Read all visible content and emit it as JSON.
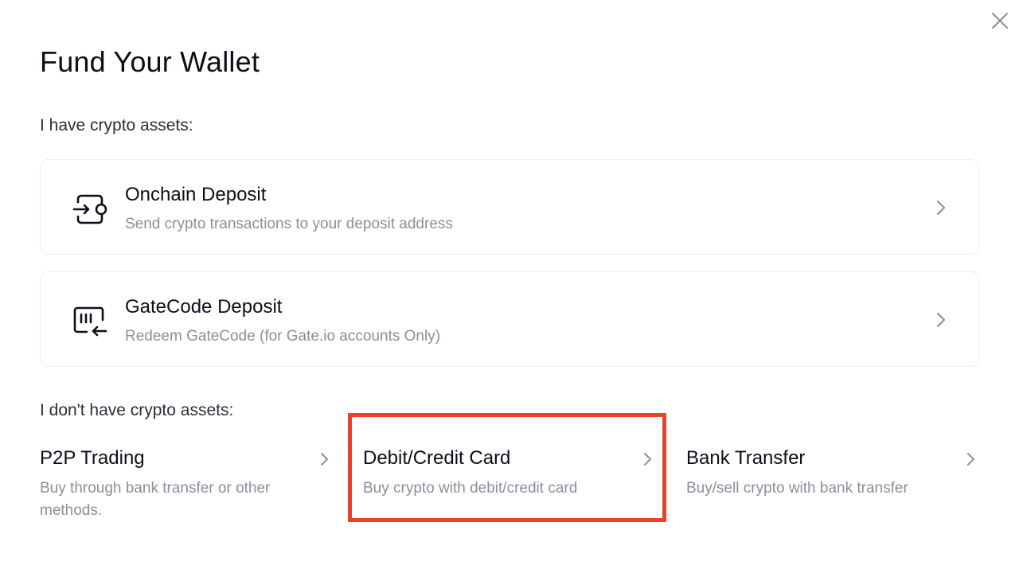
{
  "modal": {
    "title": "Fund Your Wallet",
    "close_icon": "close-icon"
  },
  "crypto_section": {
    "label": "I have crypto assets:",
    "items": [
      {
        "title": "Onchain Deposit",
        "subtitle": "Send crypto transactions to your deposit address",
        "icon": "onchain-deposit-icon"
      },
      {
        "title": "GateCode Deposit",
        "subtitle": "Redeem GateCode (for Gate.io accounts Only)",
        "icon": "gatecode-deposit-icon"
      }
    ]
  },
  "no_crypto_section": {
    "label": "I don't have crypto assets:",
    "options": [
      {
        "title": "P2P Trading",
        "subtitle": "Buy through bank transfer or other methods."
      },
      {
        "title": "Debit/Credit Card",
        "subtitle": "Buy crypto with debit/credit card"
      },
      {
        "title": "Bank Transfer",
        "subtitle": "Buy/sell crypto with bank transfer"
      }
    ]
  },
  "colors": {
    "highlight": "#e8432a",
    "text_primary": "#0c0f1a",
    "text_secondary": "#8a8f9c",
    "border": "#eceef2"
  }
}
